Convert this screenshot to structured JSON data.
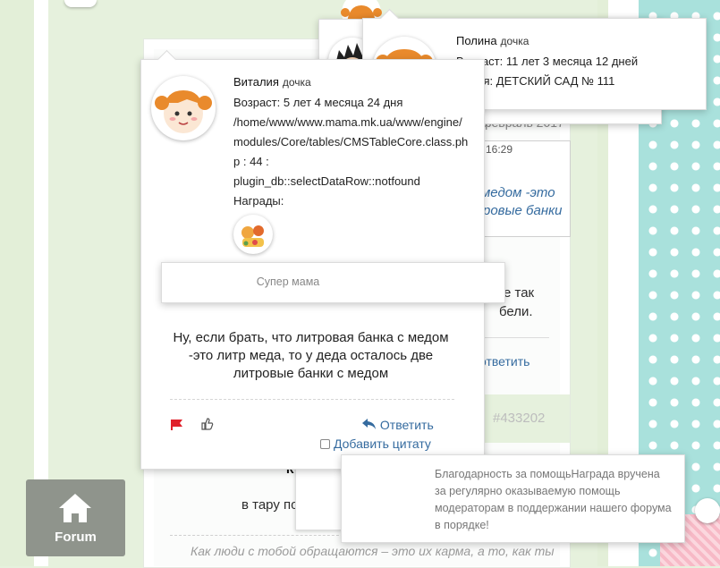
{
  "forum": {
    "label": "Forum"
  },
  "background": {
    "date_fragment": "февраль 2017",
    "quote_time": "16:29",
    "quote_line1": "медом -это",
    "quote_line2": "ровые банки",
    "right_line1": "е так",
    "right_line2": "бели.",
    "reply_fragment": "ответить",
    "post_number": "#433202",
    "bold_fragment": "Kaliabushe",
    "k_fragment": "К",
    "tare_fragment": "в тару по",
    "signature": "Как люди с тобой обращаются – это их карма, а то, как ты"
  },
  "popup_polina": {
    "name": "Полина",
    "role": "дочка",
    "age_label": "Возраст:",
    "age_value": "11 лет 3 месяца 12 дней",
    "school_label": "ся:",
    "school_value": "ДЕТСКИЙ САД № 111"
  },
  "popup_main": {
    "name": "Виталия",
    "role": "дочка",
    "age_label": "Возраст:",
    "age_value": "5 лет 4 месяца 24 дня",
    "error_line1": "/home/www/www.mama.mk.ua/www/engine/",
    "error_line2": "modules/Core/tables/CMSTableCore.class.ph",
    "error_line3": "p : 44 :",
    "error_line4": "plugin_db::selectDataRow::notfound",
    "awards_label": "Награды:",
    "message": "Ну, если брать, что литровая банка с медом -это литр меда, то у деда осталось две литровые банки с медом",
    "reply_label": "Ответить",
    "add_quote_label": "Добавить цитату"
  },
  "popup_super": {
    "text": "Супер мама"
  },
  "popup_award": {
    "text": "Благодарность за помощьНаграда вручена за регулярно оказываемую помощь модераторам в поддержании нашего форума в порядке!"
  },
  "colors": {
    "page_bg": "#e6f1dd",
    "link": "#356b9f",
    "polka_bg": "#a9e1dc",
    "flag": "#e0202a"
  }
}
